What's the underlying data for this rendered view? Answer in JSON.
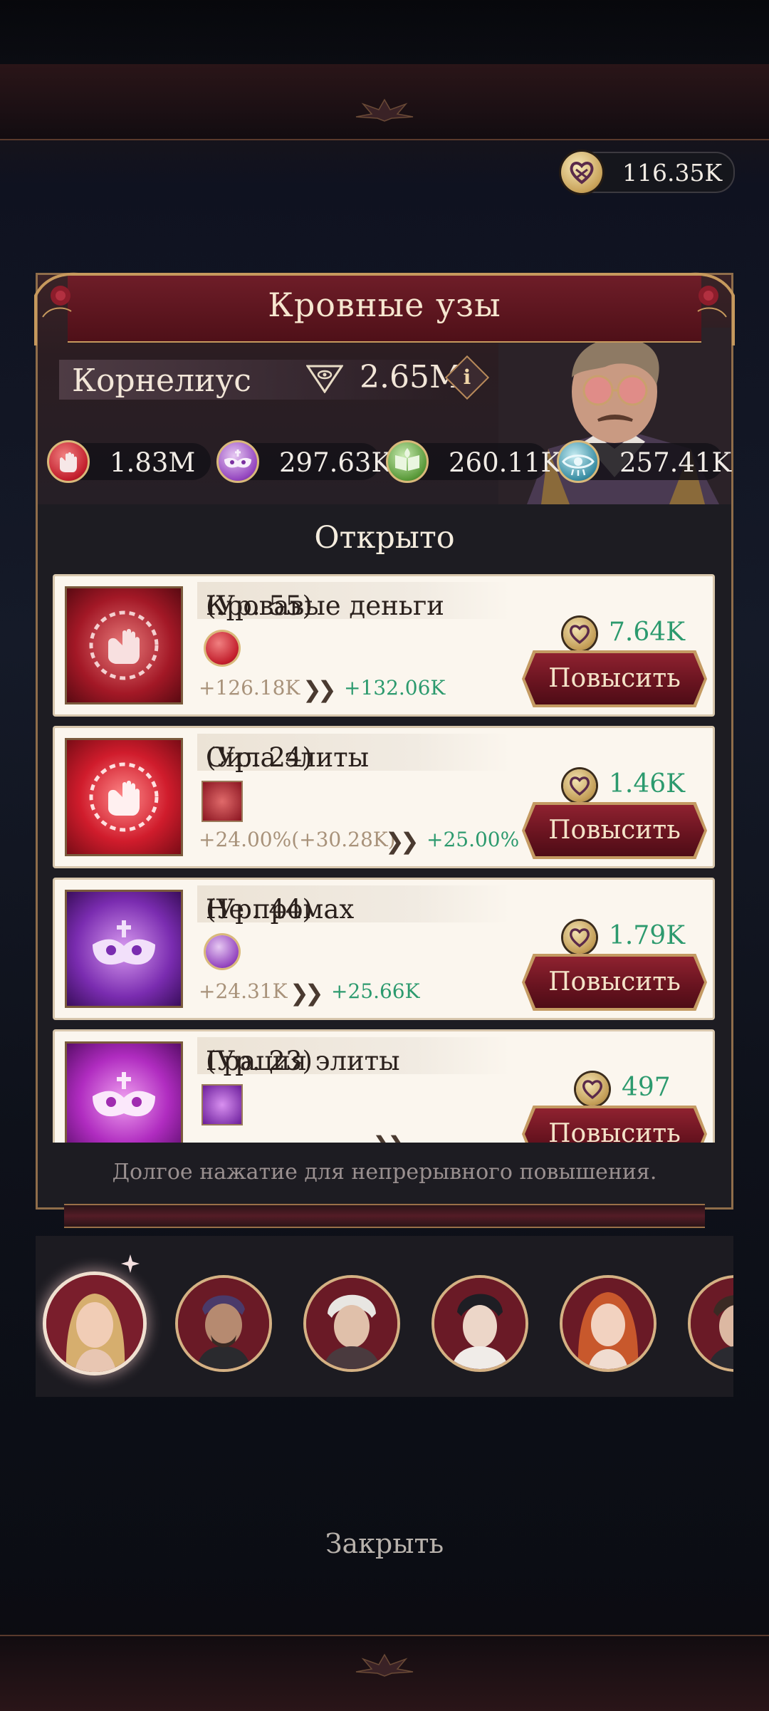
{
  "currency": {
    "value": "116.35K",
    "icon": "heart-emblem-icon"
  },
  "panel": {
    "title": "Кровные узы",
    "character": {
      "name": "Корнелиус",
      "power": "2.65M"
    },
    "stats": [
      {
        "icon": "fist-icon",
        "value": "1.83M",
        "color": "#c9303a"
      },
      {
        "icon": "mask-icon",
        "value": "297.63K",
        "color": "#8a3bb0"
      },
      {
        "icon": "book-icon",
        "value": "260.11K",
        "color": "#3f8a3a"
      },
      {
        "icon": "eye-icon",
        "value": "257.41K",
        "color": "#2a6f8a"
      }
    ],
    "section_title": "Открыто",
    "skills": [
      {
        "name": "Кровавые деньги",
        "level": "(Ур. 55)",
        "from": "+126.18K",
        "to": "+132.06K",
        "cost": "7.64K",
        "button": "Повысить",
        "theme": "red"
      },
      {
        "name": "Сила элиты",
        "level": "(Ур. 24)",
        "from": "+24.00%(+30.28K)",
        "to": "+25.00%",
        "cost": "1.46K",
        "button": "Повысить",
        "theme": "red-bright"
      },
      {
        "name": "Не промах",
        "level": "(Ур. 44)",
        "from": "+24.31K",
        "to": "+25.66K",
        "cost": "1.79K",
        "button": "Повысить",
        "theme": "purple"
      },
      {
        "name": "Грация элиты",
        "level": "(Ур. 23)",
        "from": "",
        "to": "",
        "cost": "497",
        "button": "Повысить",
        "theme": "purple-bright"
      }
    ],
    "hint": "Долгое нажатие для непрерывного повышения."
  },
  "roster": {
    "selected_index": 0,
    "count": 6
  },
  "close_label": "Закрыть"
}
